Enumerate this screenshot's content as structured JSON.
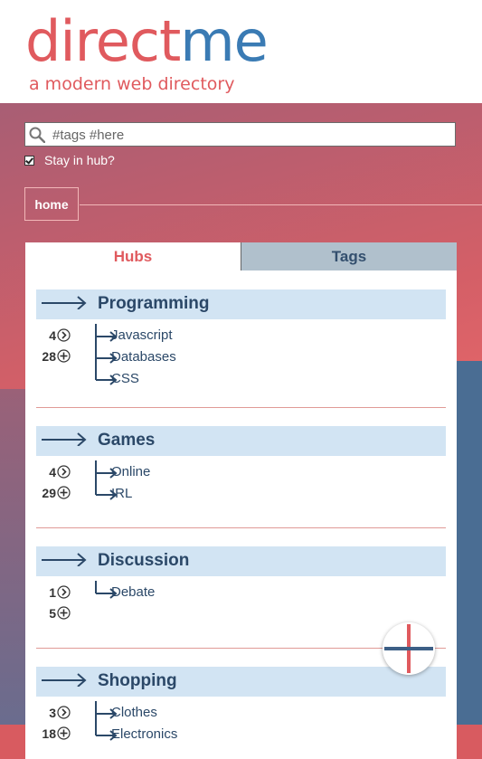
{
  "brand": {
    "name_part1": "direct",
    "name_part2": "me",
    "tagline": "a modern web directory",
    "color_primary": "#e05a5e",
    "color_secondary": "#3a7bb4"
  },
  "search": {
    "placeholder": "#tags #here",
    "value": ""
  },
  "stay_in_hub": {
    "label": "Stay in hub?",
    "checked": true
  },
  "breadcrumb": {
    "home": "home"
  },
  "tabs": {
    "hubs": "Hubs",
    "tags": "Tags",
    "active": "Hubs"
  },
  "hubs": [
    {
      "title": "Programming",
      "stat1": "4",
      "stat2": "28",
      "children": [
        "Javascript",
        "Databases",
        "CSS"
      ]
    },
    {
      "title": "Games",
      "stat1": "4",
      "stat2": "29",
      "children": [
        "Online",
        "IRL"
      ]
    },
    {
      "title": "Discussion",
      "stat1": "1",
      "stat2": "5",
      "children": [
        "Debate"
      ]
    },
    {
      "title": "Shopping",
      "stat1": "3",
      "stat2": "18",
      "children": [
        "Clothes",
        "Electronics"
      ]
    }
  ],
  "icons": {
    "search": "search-icon",
    "hub_arrow": "arrow-right-icon",
    "stat1": "chevron-circle-icon",
    "stat2": "plus-circle-icon",
    "fab": "plus-icon"
  }
}
